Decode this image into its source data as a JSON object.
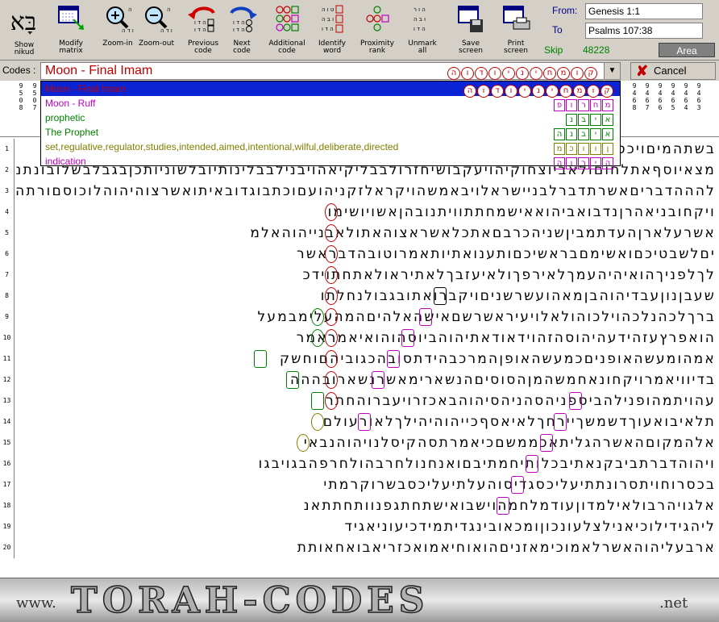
{
  "toolbar": {
    "logo": "בָּא",
    "buttons": [
      {
        "label": "Show\nnikud",
        "icon": "nikud-icon"
      },
      {
        "label": "Modify\nmatrix",
        "icon": "matrix-icon"
      },
      {
        "label": "Zoom-in",
        "icon": "zoom-in-icon"
      },
      {
        "label": "Zoom-out",
        "icon": "zoom-out-icon"
      },
      {
        "label": "Previous\ncode",
        "icon": "previous-code-icon"
      },
      {
        "label": "Next\ncode",
        "icon": "next-code-icon"
      },
      {
        "label": "Additional\ncode",
        "icon": "additional-code-icon"
      },
      {
        "label": "Identify\nword",
        "icon": "identify-word-icon"
      },
      {
        "label": "Proximity\nrank",
        "icon": "proximity-icon"
      },
      {
        "label": "Unmark\nall",
        "icon": "unmark-icon"
      },
      {
        "label": "Save\nscreen",
        "icon": "save-icon"
      },
      {
        "label": "Print\nscreen",
        "icon": "print-icon"
      }
    ]
  },
  "range": {
    "from_label": "From:",
    "from_value": "Genesis 1:1",
    "to_label": "To",
    "to_value": "Psalms 107:38"
  },
  "skip": {
    "label": "Skip",
    "value": "48228"
  },
  "area_label": "Area",
  "codes": {
    "label": "Codes :",
    "selected": "Moon - Final Imam",
    "selected_letters": "ה ו ד ו י נ י ח מ ו ק",
    "cancel_label": "Cancel",
    "options": [
      {
        "text": "Moon - Final Imam",
        "letters": "ה ו ד ו י נ י ח מ ו ק",
        "color": "#c00000",
        "selected": true
      },
      {
        "text": "Moon - Ruff",
        "letters": "פ ו ר ח מ",
        "color": "#c000c0"
      },
      {
        "text": "prophetic",
        "letters": "נ ב י א",
        "color": "#008000"
      },
      {
        "text": "The Prophet",
        "letters": "ה נ ב י א",
        "color": "#008000"
      },
      {
        "text": "set,regulative,regulator,studies,intended,aimed,intentional,wilful,deliberate,directed",
        "letters": "מ כ ו ו ן",
        "color": "#808000"
      },
      {
        "text": "indication",
        "letters": "ה ו ר י ה",
        "color": "#c000c0"
      }
    ]
  },
  "grid": {
    "row_numbers": [
      "1",
      "2",
      "3",
      "4",
      "5",
      "6",
      "7",
      "8",
      "9",
      "10",
      "11",
      "12",
      "13",
      "14",
      "15",
      "16",
      "17",
      "18",
      "19",
      "20"
    ],
    "col_headers": [
      "9\n5\n0\n8",
      "9\n5\n0\n7",
      "9\n4\n6\n8",
      "9\n4\n6\n7",
      "9\n4\n6\n6",
      "9\n4\n6\n5",
      "9\n4\n6\n4",
      "9\n4\n6\n3"
    ],
    "rows": [
      "בשתהמיםויכסומהבארץואבתההתשמוהויאמרוכתבבלשלששבעיכשלשביהיבהיזגבצל",
      "מצאיוסףאתלחוםולאביוצחוקיהויעקבושיחזרולבבליקיאהויבנילבבלינותיובלשוניותכןבגבלבשלובונתנן",
      "להההדבריםאשרתדברלבניישראלויבאמשהויקראלזקניהועםוכתבוגדובאיתואשרצוהיהוהלוכוסםורתהחודשיםעסו",
      "ויקחובניאהרןנדבואביהואאישמחתתוויתנובהןאשויושימו",
      "אשרעלארןהעדתמביןשניהכרבםאתכלאשראצוהאתולאבנייהוהאלמ",
      "יםלשבטיכםואשימםבראשיכםותענואתיותאמרוטובהדבראשר",
      "לךלפניךהואיהיהעמךלאירפךולאיעזבךלאתיראולאתחתוידכ",
      "שעבןנוןעבדיהוהבןמאהועשרשניםויקברואתובגבולנחלתו",
      "ברךלכהנלכהוילכוהולאלויעיראשרשםאישהאלהיםהמהעלימבמעל",
      "הואפרץעזהידעהיהוסהזהוידאודאתיהוהביוסהוהואיאמראמר",
      "אמהומעשהאופניםכמעשהאופןהמרכבהידתסובהכגוביהםוחשק",
      "בדיוויאמרויקחונאחמשהמןהסוסיםהנשארימאשרנשארובההה",
      "עהויתמהופנילהביספניהסהניהסיהוהבאכזרויעברוהחתר",
      "תלאיבואעוךדשמשךיירחךלאיאסףכייהוהיהילךלאורעולם",
      "אלהמקוםהאשרהגליתאכממשםכיאמרתסהקיסלנויהוהנבאי",
      "ויהוהדברתביבקנאתיבכלותיחמתיבםואנחנולחרבהולחרפהבגויבגו",
      "בכסרוחויתסרונתתיעליכסגדיסוהעלתיעליכסבשרוקרמתי",
      "אלגויהרבולאילמדוןעודמלחמהוישבואישתחתגפנוותחתתאנ",
      "ליהגידילוכיאנילצלעונכוןומכאובינגדיתמידכיעוניאגיד",
      "ארבעליהוהאשרלאמוכימאזניםהואוחיאמואכזריאבואחאותת"
    ]
  },
  "footer": {
    "www": "www.",
    "brand": "TORAH-CODES",
    ".net": ".net"
  }
}
